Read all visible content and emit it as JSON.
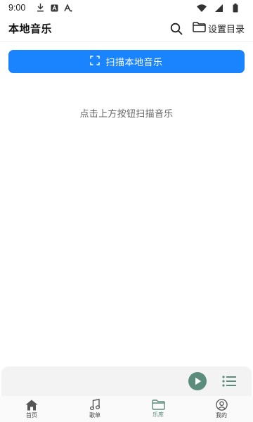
{
  "status_bar": {
    "time": "9:00",
    "icons": [
      "download-icon",
      "a-box-icon",
      "a-text-icon",
      "wifi-icon",
      "signal-icon",
      "battery-icon"
    ]
  },
  "app_bar": {
    "title": "本地音乐",
    "search_icon": "search-icon",
    "set_dir_label": "设置目录"
  },
  "scan_button": {
    "label": "扫描本地音乐",
    "color": "#1a84ff"
  },
  "empty_hint": "点击上方按钮扫描音乐",
  "player": {
    "accent": "#5b8c7c"
  },
  "nav": {
    "items": [
      {
        "label": "首页",
        "icon": "home-icon",
        "active": false
      },
      {
        "label": "歌单",
        "icon": "music-note-icon",
        "active": false
      },
      {
        "label": "乐库",
        "icon": "folder-icon",
        "active": true
      },
      {
        "label": "我的",
        "icon": "profile-icon",
        "active": false
      }
    ]
  }
}
